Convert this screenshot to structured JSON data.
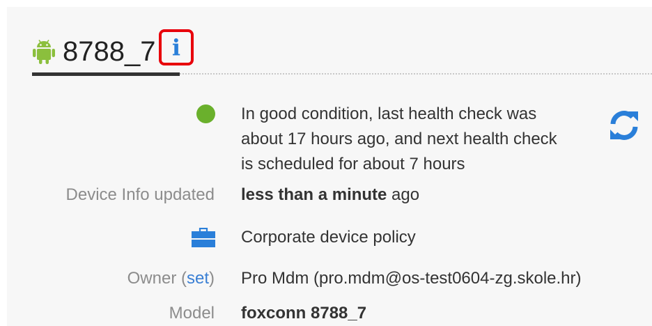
{
  "device": {
    "title": "8788_7",
    "info_icon_glyph": "i",
    "icons": {
      "platform": "android-icon",
      "info": "info-icon"
    },
    "colors": {
      "android": "#8bbf3d",
      "info": "#2a7fd9",
      "highlight": "#e8000b"
    }
  },
  "health": {
    "status_color": "#6ab02c",
    "text_line1": "In good condition, last health check was",
    "text_line2": "about 17 hours ago, and next health check",
    "text_line3": "is scheduled for about 7 hours",
    "refresh_icon": "refresh-icon"
  },
  "device_info": {
    "label": "Device Info updated",
    "value_bold": "less than a minute",
    "value_suffix": " ago"
  },
  "policy": {
    "icon": "briefcase-icon",
    "value": "Corporate device policy"
  },
  "owner": {
    "label": "Owner (",
    "link": "set",
    "label_close": ")",
    "value": "Pro Mdm (pro.mdm@os-test0604-zg.skole.hr)"
  },
  "model": {
    "label": "Model",
    "value": "foxconn 8788_7"
  }
}
